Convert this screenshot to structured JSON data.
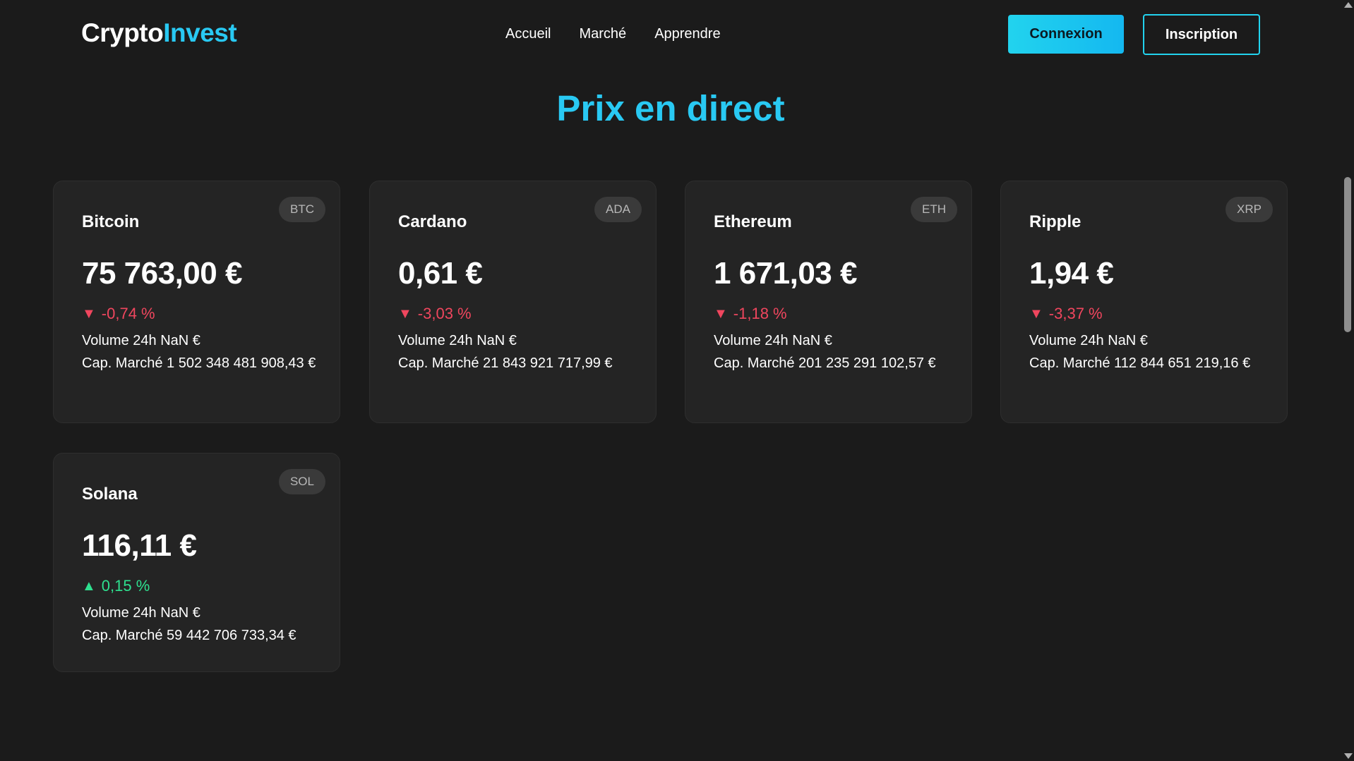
{
  "brand": {
    "part1": "Crypto",
    "part2": "Invest",
    "accent_color": "#29c9f3"
  },
  "nav": {
    "items": [
      {
        "label": "Accueil"
      },
      {
        "label": "Marché"
      },
      {
        "label": "Apprendre"
      }
    ]
  },
  "auth": {
    "login_label": "Connexion",
    "signup_label": "Inscription"
  },
  "page": {
    "title": "Prix en direct"
  },
  "cards": [
    {
      "name": "Bitcoin",
      "symbol": "BTC",
      "price": "75 763,00 €",
      "change": "-0,74 %",
      "arrow": "▼",
      "direction": "down",
      "volume": "Volume 24h NaN €",
      "market_cap": "Cap. Marché 1 502 348 481 908,43 €"
    },
    {
      "name": "Cardano",
      "symbol": "ADA",
      "price": "0,61 €",
      "change": "-3,03 %",
      "arrow": "▼",
      "direction": "down",
      "volume": "Volume 24h NaN €",
      "market_cap": "Cap. Marché 21 843 921 717,99 €"
    },
    {
      "name": "Ethereum",
      "symbol": "ETH",
      "price": "1 671,03 €",
      "change": "-1,18 %",
      "arrow": "▼",
      "direction": "down",
      "volume": "Volume 24h NaN €",
      "market_cap": "Cap. Marché 201 235 291 102,57 €"
    },
    {
      "name": "Ripple",
      "symbol": "XRP",
      "price": "1,94 €",
      "change": "-3,37 %",
      "arrow": "▼",
      "direction": "down",
      "volume": "Volume 24h NaN €",
      "market_cap": "Cap. Marché 112 844 651 219,16 €"
    },
    {
      "name": "Solana",
      "symbol": "SOL",
      "price": "116,11 €",
      "change": "0,15 %",
      "arrow": "▲",
      "direction": "up",
      "volume": "Volume 24h NaN €",
      "market_cap": "Cap. Marché 59 442 706 733,34 €"
    }
  ],
  "colors": {
    "down": "#f0465e",
    "up": "#2ee08f",
    "background": "#1b1b1b",
    "card": "#242424"
  }
}
